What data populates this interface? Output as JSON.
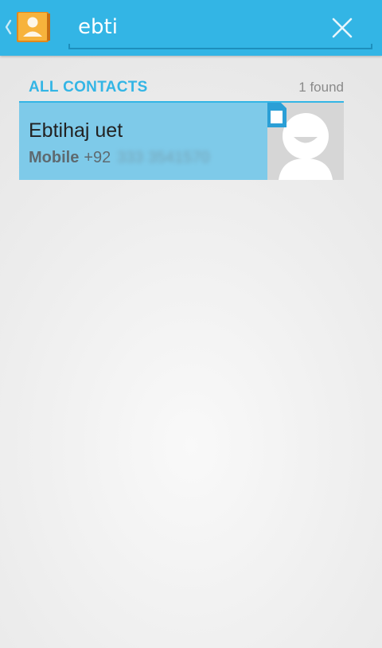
{
  "action_bar": {
    "up_icon": "chevron-left-icon",
    "app_icon": "contacts-app-icon",
    "search": {
      "query": "ebti",
      "clear_icon": "close-icon"
    }
  },
  "results": {
    "section_title": "ALL CONTACTS",
    "count_text": "1 found",
    "contacts": [
      {
        "name": "Ebtihaj uet",
        "phone_type": "Mobile",
        "phone_prefix": "+92",
        "phone_rest": "333 3541570",
        "storage_icon": "sim-card-icon",
        "avatar_icon": "default-avatar-icon"
      }
    ]
  },
  "colors": {
    "accent": "#33b5e5",
    "row_highlight": "#7ecae9"
  }
}
